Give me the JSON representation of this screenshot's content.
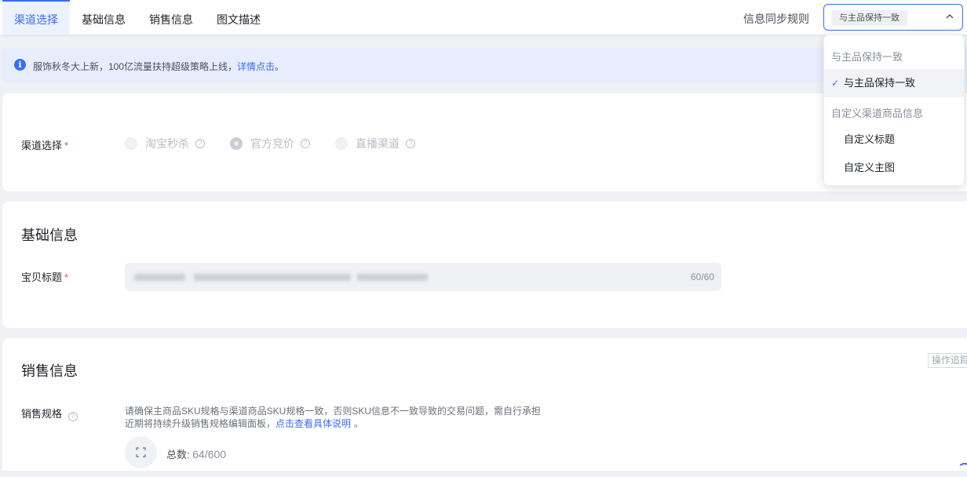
{
  "tabs": [
    {
      "label": "渠道选择",
      "active": true
    },
    {
      "label": "基础信息",
      "active": false
    },
    {
      "label": "销售信息",
      "active": false
    },
    {
      "label": "图文描述",
      "active": false
    }
  ],
  "sync": {
    "label": "信息同步规则",
    "selected_tag": "与主品保持一致"
  },
  "notice": {
    "text": "服饰秋冬大上新，100亿流量扶持超级策略上线，",
    "link": "详情点击",
    "end": "。"
  },
  "channel": {
    "label": "渠道选择",
    "required_mark": "*",
    "options": [
      {
        "label": "淘宝秒杀",
        "checked": false
      },
      {
        "label": "官方竞价",
        "checked": true
      },
      {
        "label": "直播渠道",
        "checked": false
      }
    ]
  },
  "basic": {
    "title": "基础信息",
    "item_title_label": "宝贝标题",
    "required_mark": "*",
    "counter": "60/60"
  },
  "sales": {
    "title": "销售信息",
    "op_button": "操作追踪",
    "spec_label": "销售规格",
    "desc_line1": "请确保主商品SKU规格与渠道商品SKU规格一致，否则SKU信息不一致导致的交易问题，需自行承担",
    "desc_line2": "近期将持续升级销售规格编辑面板，",
    "desc_link": "点击查看具体说明",
    "desc_end": "。",
    "total_label": "总数:",
    "total_value": "64/600"
  },
  "dropdown": {
    "group1": "与主品保持一致",
    "option1": "与主品保持一致",
    "group2": "自定义渠道商品信息",
    "option2": "自定义标题",
    "option3": "自定义主图"
  },
  "colors": {
    "accent": "#3b6cf6",
    "required": "#f54a45",
    "background": "#f0f1f5"
  }
}
